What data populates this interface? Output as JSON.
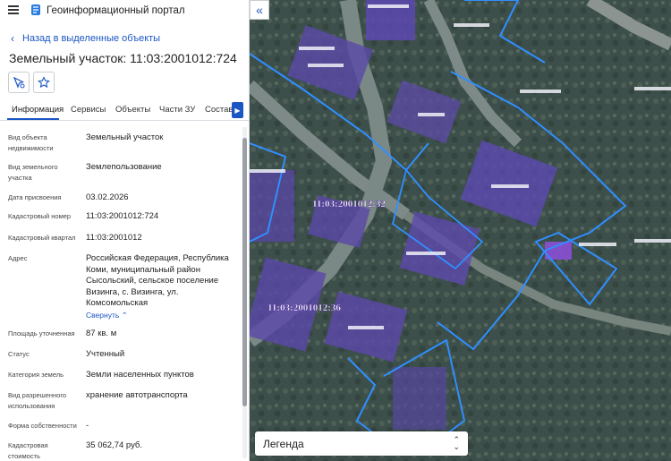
{
  "app": {
    "title": "Геоинформационный портал"
  },
  "nav": {
    "back_label": "Назад в выделенные объекты"
  },
  "object": {
    "title": "Земельный участок: 11:03:2001012:724"
  },
  "tabs": [
    "Информация",
    "Сервисы",
    "Объекты",
    "Части ЗУ",
    "Состав"
  ],
  "properties": [
    {
      "label": "Вид объекта недвижимости",
      "value": "Земельный участок"
    },
    {
      "label": "Вид земельного участка",
      "value": "Землепользование"
    },
    {
      "label": "Дата присвоения",
      "value": "03.02.2026"
    },
    {
      "label": "Кадастровый номер",
      "value": "11:03:2001012:724"
    },
    {
      "label": "Кадастровый квартал",
      "value": "11:03:2001012"
    },
    {
      "label": "Адрес",
      "value": "Российская Федерация, Республика Коми, муниципальный район Сысольский, сельское поселение Визинга, с. Визинга, ул. Комсомольская",
      "link": "Свернуть"
    },
    {
      "label": "Площадь уточненная",
      "value": "87 кв. м"
    },
    {
      "label": "Статус",
      "value": "Учтенный"
    },
    {
      "label": "Категория земель",
      "value": "Земли населенных пунктов"
    },
    {
      "label": "Вид разрешенного использования",
      "value": "хранение автотранспорта"
    },
    {
      "label": "Форма собственности",
      "value": "-"
    },
    {
      "label": "Кадастровая стоимость",
      "value": "35 062,74 руб."
    }
  ],
  "map": {
    "labels": [
      "11:03:2001012:32",
      "11:03:2001012:36"
    ],
    "legend_label": "Легенда"
  },
  "colors": {
    "accent": "#1a56c4",
    "boundary": "#2f8fff",
    "selected_parcel": "#7b4fd6"
  }
}
